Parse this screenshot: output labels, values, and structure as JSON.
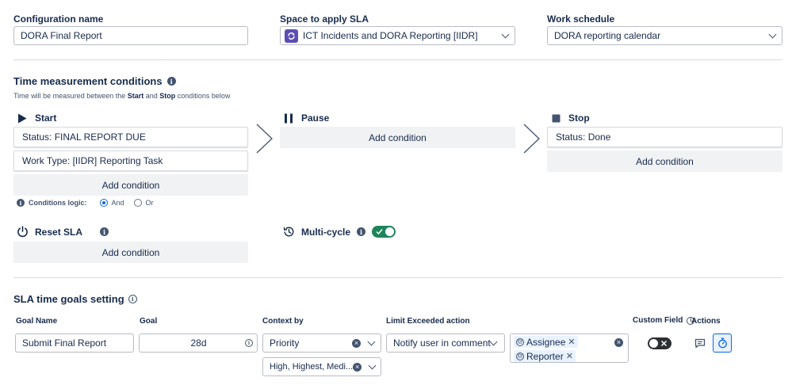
{
  "config": {
    "name_label": "Configuration name",
    "name_value": "DORA Final Report",
    "space_label": "Space to apply SLA",
    "space_value": "ICT Incidents and DORA Reporting [IIDR]",
    "schedule_label": "Work schedule",
    "schedule_value": "DORA reporting calendar"
  },
  "time_measurement": {
    "title": "Time measurement conditions",
    "subtitle_pre": "Time will be measured between the ",
    "subtitle_start": "Start",
    "subtitle_mid": " and ",
    "subtitle_stop": "Stop",
    "subtitle_post": " conditions below",
    "start": {
      "title": "Start",
      "conditions": [
        "Status: FINAL REPORT DUE",
        "Work Type: [IIDR] Reporting Task"
      ],
      "add_label": "Add condition",
      "logic_label": "Conditions logic:",
      "logic_and": "And",
      "logic_or": "Or",
      "logic_selected": "And"
    },
    "pause": {
      "title": "Pause",
      "add_label": "Add condition"
    },
    "stop": {
      "title": "Stop",
      "conditions": [
        "Status: Done"
      ],
      "add_label": "Add condition"
    },
    "reset": {
      "title": "Reset SLA",
      "add_label": "Add condition"
    },
    "multicycle": {
      "title": "Multi-cycle",
      "enabled": true
    }
  },
  "goals": {
    "title": "SLA time goals setting",
    "columns": {
      "goal_name": "Goal Name",
      "goal": "Goal",
      "context": "Context by",
      "limit": "Limit Exceeded action",
      "custom_field": "Custom Field",
      "actions": "Actions"
    },
    "row": {
      "goal_name": "Submit Final Report",
      "goal": "28d",
      "context_primary": "Priority",
      "context_values": "High, Highest, Medi...",
      "limit_action": "Notify user in comment",
      "recipients": [
        "Assignee",
        "Reporter"
      ],
      "custom_field_enabled": false
    }
  },
  "colors": {
    "toggle_on": "#1f845a",
    "accent": "#0c66e4",
    "space_icon": "#5e4db2"
  }
}
